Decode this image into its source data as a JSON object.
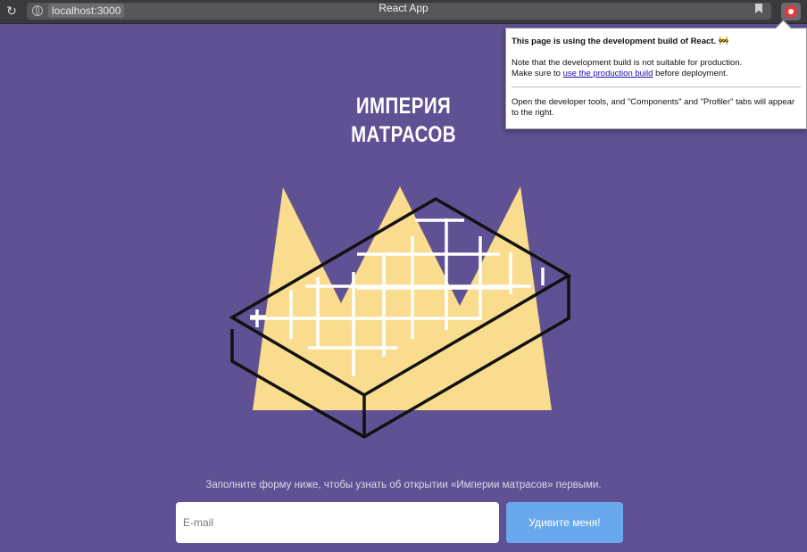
{
  "browser": {
    "url": "localhost:3000",
    "title": "React App"
  },
  "popup": {
    "heading": "This page is using the development build of React. 🚧",
    "line1": "Note that the development build is not suitable for production.",
    "line2_before": "Make sure to ",
    "line2_link": "use the production build",
    "line2_after": " before deployment.",
    "line3": "Open the developer tools, and \"Components\" and \"Profiler\" tabs will appear to the right."
  },
  "hero": {
    "title_line1": "ИМПЕРИЯ",
    "title_line2": "МАТРАСОВ"
  },
  "form": {
    "subtitle": "Заполните форму ниже, чтобы узнать об открытии «Империи матрасов» первыми.",
    "email_placeholder": "E-mail",
    "submit_label": "Удивите меня!"
  },
  "colors": {
    "background": "#5f5193",
    "crown": "#f9dc8d",
    "button": "#6aa8ee"
  }
}
